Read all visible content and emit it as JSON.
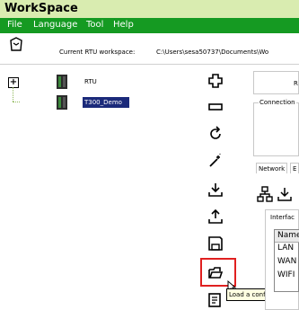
{
  "app": {
    "title": "WorkSpace"
  },
  "menu": {
    "items": [
      "File",
      "Language",
      "Tool",
      "Help"
    ]
  },
  "workspace": {
    "label": "Current RTU workspace:",
    "path": "C:\\Users\\sesa50737\\Documents\\Wo"
  },
  "tree": {
    "root_label": "RTU",
    "child_label": "T300_Demo"
  },
  "toolbar": {
    "tooltip": "Load a configuration"
  },
  "right_panel": {
    "top_label": "R",
    "connection_label": "Connection",
    "tabs": [
      "Network",
      "E"
    ],
    "interface_label": "Interfac",
    "list_header": "Name",
    "list_items": [
      "LAN",
      "WAN",
      "WIFI"
    ]
  }
}
